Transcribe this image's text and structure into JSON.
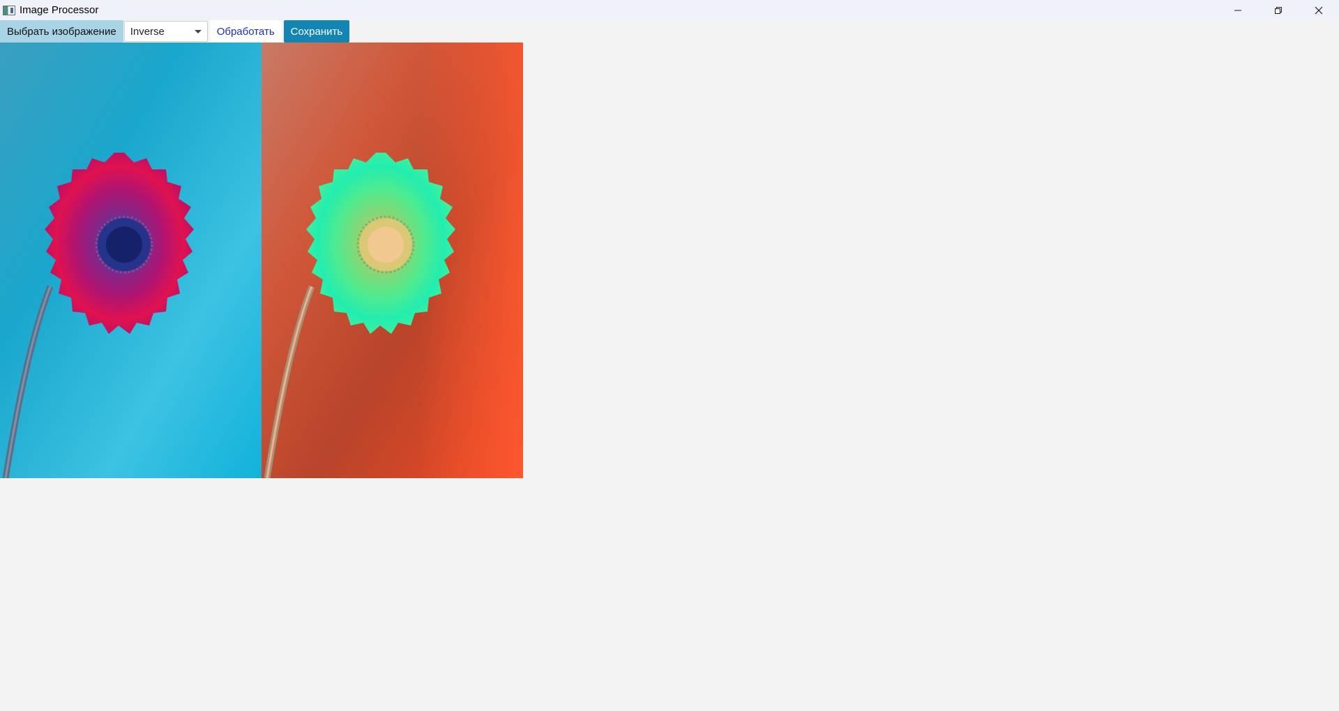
{
  "window": {
    "title": "Image Processor",
    "icon": "app-icon",
    "controls": [
      "minimize-icon",
      "restore-icon",
      "close-icon"
    ]
  },
  "toolbar": {
    "choose_label": "Выбрать изображение",
    "filter_selected": "Inverse",
    "process_label": "Обработать",
    "save_label": "Сохранить"
  },
  "colors": {
    "choose_bg": "#a8d4e6",
    "save_bg": "#1285b4",
    "process_text": "#1a2fbf",
    "original_bg": "#1ab0d4",
    "original_flower": "#c8105a",
    "processed_bg": "#e0452a",
    "processed_flower": "#3ef0a8"
  },
  "images": {
    "original": "gerbera-original",
    "processed": "gerbera-inverse"
  }
}
